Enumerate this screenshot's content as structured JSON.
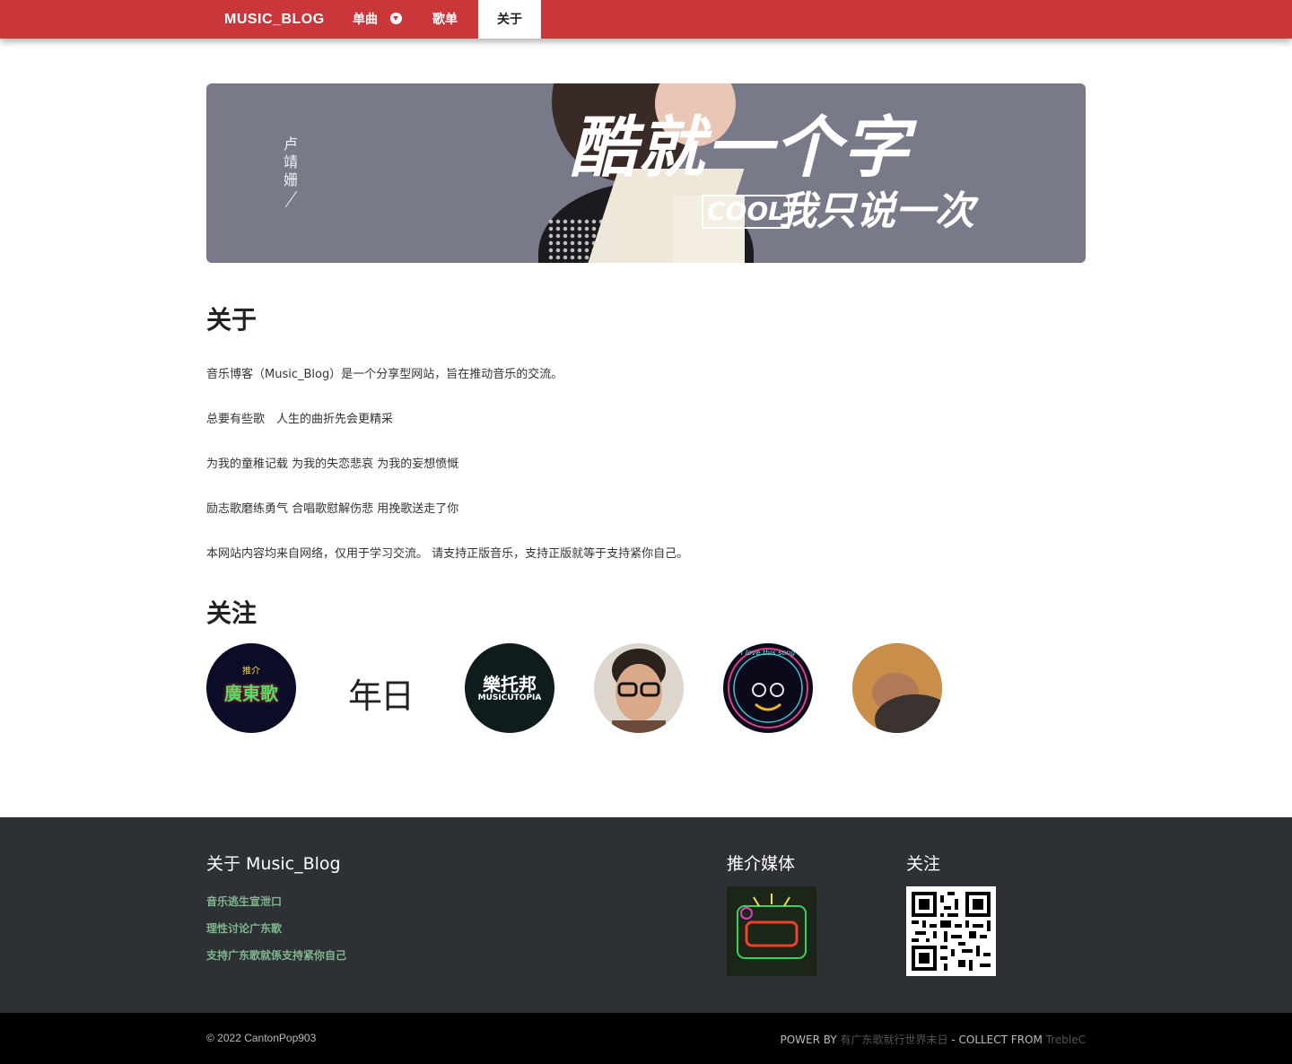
{
  "navbar": {
    "brand": "MUSIC_BLOG",
    "items": [
      {
        "label": "单曲"
      },
      {
        "label": "歌单"
      },
      {
        "label": "关于"
      }
    ],
    "accent_color": "#c9373a"
  },
  "banner": {
    "vertical_name": "卢靖姗",
    "headline": "酷就一个字",
    "cool_tag": "COOL",
    "subline": "我只说一次"
  },
  "about": {
    "title": "关于",
    "paragraphs": [
      "音乐博客（Music_Blog）是一个分享型网站，旨在推动音乐的交流。",
      "总要有些歌　人生的曲折先会更精采",
      "为我的童稚记载 为我的失恋悲哀 为我的妄想愤慨",
      "励志歌磨练勇气 合唱歌慰解伤悲 用挽歌送走了你",
      "本网站内容均来自网络，仅用于学习交流。 请支持正版音乐，支持正版就等于支持紧你自己。"
    ]
  },
  "follow": {
    "title": "关注",
    "avatars": [
      {
        "name": "廣東歌",
        "caption": "推介"
      },
      {
        "name": "年日"
      },
      {
        "name": "樂托邦",
        "sub": "MUSICUTOPIA"
      },
      {
        "name": "person-glasses"
      },
      {
        "name": "I love this song"
      },
      {
        "name": "person-sleeping"
      }
    ]
  },
  "footer": {
    "about_title": "关于 Music_Blog",
    "links": [
      "音乐逃生宣泄口",
      "理性讨论广东歌",
      "支持广东歌就係支持紧你自己"
    ],
    "media_title": "推介媒体",
    "follow_title": "关注",
    "bg_color": "#2d3135",
    "link_color": "#7fb68c"
  },
  "bottom": {
    "copyright": "© 2022 CantonPop903",
    "power_by": "POWER BY",
    "power_name": "有广东歌就行世界末日",
    "collect_from": "- COLLECT FROM",
    "collect_name": "TrebleC"
  }
}
